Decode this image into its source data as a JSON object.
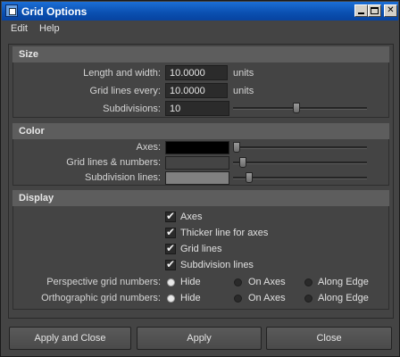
{
  "window": {
    "title": "Grid Options"
  },
  "menu": {
    "edit": "Edit",
    "help": "Help"
  },
  "size": {
    "header": "Size",
    "length_label": "Length and width:",
    "length_value": "10.0000",
    "length_units": "units",
    "grid_every_label": "Grid lines every:",
    "grid_every_value": "10.0000",
    "grid_every_units": "units",
    "subdivisions_label": "Subdivisions:",
    "subdivisions_value": "10",
    "subdivisions_slider": 0.48
  },
  "color": {
    "header": "Color",
    "axes_label": "Axes:",
    "axes_color": "#000000",
    "axes_slider": 0.0,
    "grid_numbers_label": "Grid lines & numbers:",
    "grid_numbers_color": "#444444",
    "grid_numbers_slider": 0.05,
    "subdivision_label": "Subdivision lines:",
    "subdivision_color": "#808080",
    "subdivision_slider": 0.1
  },
  "display": {
    "header": "Display",
    "axes_cb": "Axes",
    "thicker_cb": "Thicker line for axes",
    "grid_lines_cb": "Grid lines",
    "subdivision_cb": "Subdivision lines",
    "perspective_label": "Perspective grid numbers:",
    "orthographic_label": "Orthographic grid numbers:",
    "opt_hide": "Hide",
    "opt_on_axes": "On Axes",
    "opt_along_edge": "Along Edge",
    "perspective_selected": "Hide",
    "orthographic_selected": "Hide"
  },
  "buttons": {
    "apply_close": "Apply and Close",
    "apply": "Apply",
    "close": "Close"
  }
}
